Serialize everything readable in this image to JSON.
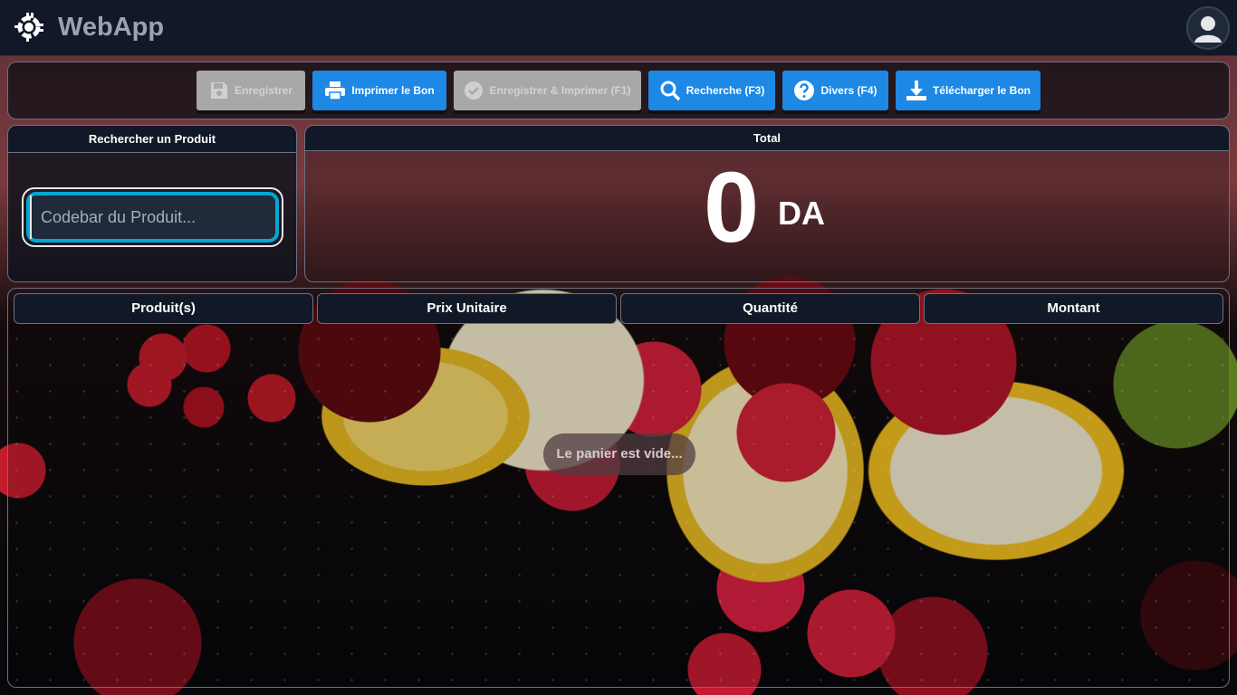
{
  "app": {
    "brand": "WebApp"
  },
  "toolbar": {
    "buttons": [
      {
        "label": "Enregistrer",
        "icon": "floppy-icon",
        "enabled": false
      },
      {
        "label": "Imprimer le Bon",
        "icon": "printer-icon",
        "enabled": true
      },
      {
        "label": "Enregistrer & Imprimer (F1)",
        "icon": "check-circle-icon",
        "enabled": false
      },
      {
        "label": "Recherche (F3)",
        "icon": "search-icon",
        "enabled": true
      },
      {
        "label": "Divers (F4)",
        "icon": "question-circle-icon",
        "enabled": true
      },
      {
        "label": "Télécharger le Bon",
        "icon": "download-icon",
        "enabled": true
      }
    ]
  },
  "search": {
    "title": "Rechercher un Produit",
    "placeholder": "Codebar du Produit...",
    "value": ""
  },
  "total": {
    "title": "Total",
    "value": "0",
    "currency": "DA"
  },
  "cart": {
    "columns": [
      "Produit(s)",
      "Prix Unitaire",
      "Quantité",
      "Montant"
    ],
    "empty_message": "Le panier est vide..."
  },
  "colors": {
    "accent": "#1e88e5",
    "input_focus": "#00a8d4",
    "header_bg": "#111827"
  }
}
